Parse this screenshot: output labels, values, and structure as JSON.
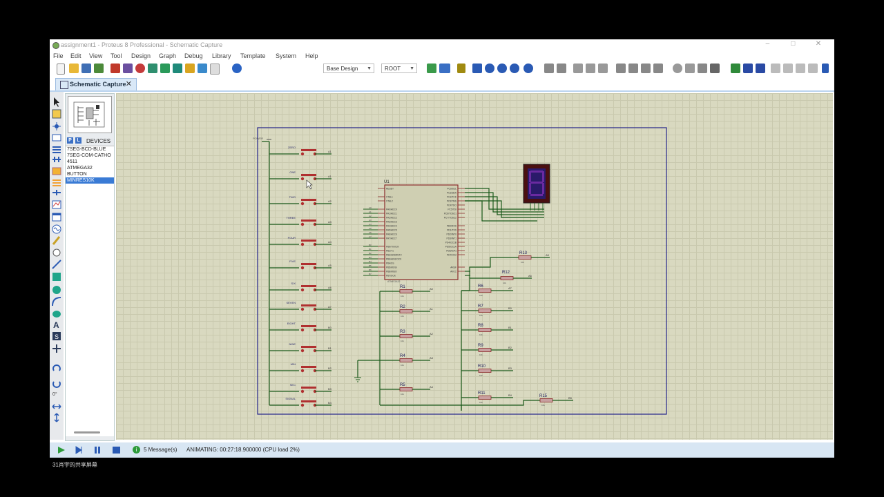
{
  "window": {
    "title": "assignment1 - Proteus 8 Professional - Schematic Capture",
    "controls": [
      "–",
      "□",
      "✕"
    ]
  },
  "menu": [
    "File",
    "Edit",
    "View",
    "Tool",
    "Design",
    "Graph",
    "Debug",
    "Library",
    "Template",
    "System",
    "Help"
  ],
  "toolbar": {
    "design_select": "Base Design",
    "root_select": "ROOT"
  },
  "tab": {
    "label": "Schematic Capture",
    "close": "✕"
  },
  "device_panel": {
    "p_button": "P",
    "l_button": "L",
    "header": "DEVICES",
    "items": [
      "7SEG-BCD-BLUE",
      "7SEG-COM-CATHO",
      "4511",
      "ATMEGA32",
      "BUTTON",
      "MINRES10K"
    ],
    "selected_index": 5
  },
  "left_tools": {
    "rotation": "0°"
  },
  "schematic": {
    "buttons": [
      "ZERO",
      "ONE",
      "TWO",
      "THREE",
      "FOUR",
      "FIVE",
      "SIX",
      "SEVEN",
      "EIGHT",
      "NINE",
      "MIN",
      "SEC",
      "SIGNAL"
    ],
    "button_nets": [
      "A1",
      "A1",
      "A2",
      "A3",
      "A4",
      "A5",
      "A6",
      "A7",
      "B0",
      "B1",
      "B2",
      "B3",
      "B4"
    ],
    "mcu": {
      "ref": "U1",
      "part": "ATMEGA32",
      "left_pins": [
        "RESET",
        "",
        "XTAL1",
        "XTAL2",
        "",
        "PA0/ADC0",
        "PA1/ADC1",
        "PA2/ADC2",
        "PA3/ADC3",
        "PA4/ADC4",
        "PA5/ADC5",
        "PA6/ADC6",
        "PA7/ADC7",
        "",
        "PB0/T0/XCK",
        "PB1/T1",
        "PB2/AIN0/INT2",
        "PB3/AIN1/OC0",
        "PB4/SS",
        "PB5/MOSI",
        "PB6/MISO",
        "PB7/SCK"
      ],
      "right_pins": [
        "PC0/SCL",
        "PC1/SDA",
        "PC2/TCK",
        "PC3/TMS",
        "PC4/TDO",
        "PC5/TDI",
        "PC6/TOSC1",
        "PC7/TOSC2",
        "",
        "PD0/RXD",
        "PD1/TXD",
        "PD2/INT0",
        "PD3/INT1",
        "PD4/OC1B",
        "PD5/OC1A",
        "PD6/ICP1",
        "PD7/OC2",
        "",
        "",
        "AREF",
        "AVCC"
      ]
    },
    "resistors_left": [
      {
        "ref": "R1",
        "val": "10k",
        "net": "A0"
      },
      {
        "ref": "R2",
        "val": "10k",
        "net": "A1"
      },
      {
        "ref": "R3",
        "val": "10k",
        "net": "A2"
      },
      {
        "ref": "R4",
        "val": "10k",
        "net": "A3"
      },
      {
        "ref": "R5",
        "val": "10k",
        "net": "A4"
      }
    ],
    "resistors_right": [
      {
        "ref": "R6",
        "val": "10k",
        "net": "A7"
      },
      {
        "ref": "R7",
        "val": "10k",
        "net": "B0"
      },
      {
        "ref": "R8",
        "val": "10k",
        "net": "B1"
      },
      {
        "ref": "R9",
        "val": "10k",
        "net": "B2"
      },
      {
        "ref": "R10",
        "val": "10k",
        "net": "B3"
      },
      {
        "ref": "R11",
        "val": "10k",
        "net": "B4"
      }
    ],
    "r12": {
      "ref": "R12",
      "val": "10k",
      "net": "A6"
    },
    "r13": {
      "ref": "R13",
      "val": "10k",
      "net": "A5"
    },
    "r15": {
      "ref": "R15",
      "val": "10k",
      "net": "B5"
    },
    "power_label": "POWER"
  },
  "status": {
    "messages": "5 Message(s)",
    "animating": "ANIMATING: 00:27:18.900000 (CPU load 2%)"
  },
  "caption": "31肖宇的共享屏幕"
}
